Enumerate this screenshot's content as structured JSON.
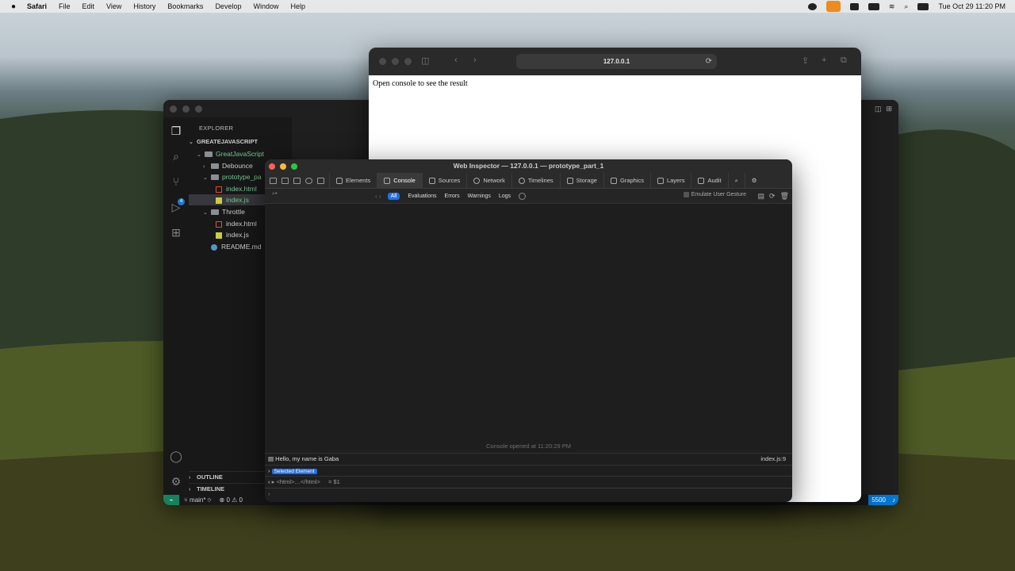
{
  "menubar": {
    "items": [
      "Safari",
      "File",
      "Edit",
      "View",
      "History",
      "Bookmarks",
      "Develop",
      "Window",
      "Help"
    ],
    "clock": "Tue Oct 29  11:20 PM"
  },
  "vscode": {
    "explorer_title": "EXPLORER",
    "root": "GREATEJAVASCRIPT",
    "tree": [
      {
        "label": "GreatJavaScript",
        "kind": "folder-open"
      },
      {
        "label": "Debounce",
        "kind": "folder"
      },
      {
        "label": "prototype_pa",
        "kind": "folder-open"
      },
      {
        "label": "index.html",
        "kind": "html"
      },
      {
        "label": "index.js",
        "kind": "js"
      },
      {
        "label": "Throttle",
        "kind": "folder-open"
      },
      {
        "label": "index.html",
        "kind": "html"
      },
      {
        "label": "index.js",
        "kind": "js"
      },
      {
        "label": "README.md",
        "kind": "info"
      }
    ],
    "outline": "OUTLINE",
    "timeline": "TIMELINE",
    "scm_badge": "4",
    "status": {
      "branch": "main*",
      "problems": "⊗ 0 ⚠ 0",
      "port": "5500"
    }
  },
  "safari": {
    "url": "127.0.0.1",
    "page_text": "Open console to see the result"
  },
  "inspector": {
    "title": "Web Inspector — 127.0.0.1 — prototype_part_1",
    "tabs": [
      "Elements",
      "Console",
      "Sources",
      "Network",
      "Timelines",
      "Storage",
      "Graphics",
      "Layers",
      "Audit"
    ],
    "active_tab": "Console",
    "filters": [
      "All",
      "Evaluations",
      "Errors",
      "Warnings",
      "Logs"
    ],
    "emulate": "Emulate User Gesture",
    "console_opened": "Console opened at 11:20:29 PM",
    "log_message": "Hello, my name is Gaba",
    "log_source": "index.js:9",
    "selected_element": "Selected Element",
    "html_node": "<html>…</html>",
    "html_eq": "= $1"
  }
}
